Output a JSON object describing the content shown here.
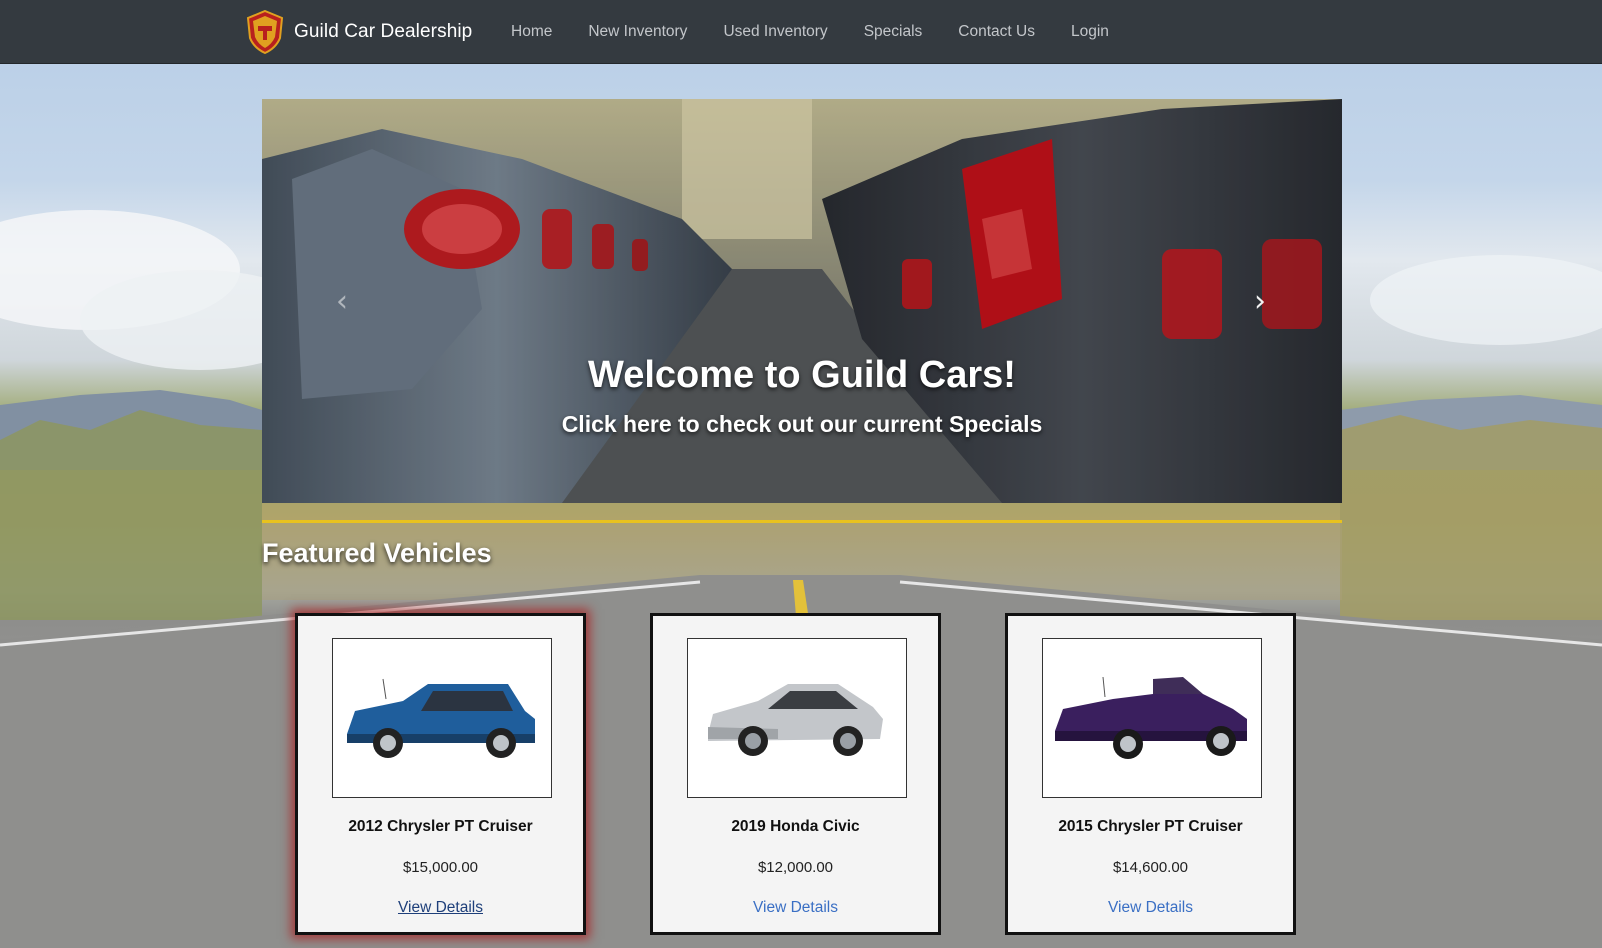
{
  "navbar": {
    "brand": "Guild Car Dealership",
    "items": [
      {
        "label": "Home"
      },
      {
        "label": "New Inventory"
      },
      {
        "label": "Used Inventory"
      },
      {
        "label": "Specials"
      },
      {
        "label": "Contact Us"
      },
      {
        "label": "Login"
      }
    ]
  },
  "carousel": {
    "title": "Welcome to Guild Cars!",
    "subtitle": "Click here to check out our current Specials",
    "prev_icon": "‹",
    "next_icon": "›"
  },
  "featured": {
    "heading": "Featured Vehicles",
    "vehicles": [
      {
        "title": "2012 Chrysler PT Cruiser",
        "price": "$15,000.00",
        "link": "View Details",
        "color": "#1f5e9c"
      },
      {
        "title": "2019 Honda Civic",
        "price": "$12,000.00",
        "link": "View Details",
        "color": "#b9bcc0"
      },
      {
        "title": "2015 Chrysler PT Cruiser",
        "price": "$14,600.00",
        "link": "View Details",
        "color": "#3a1f5e"
      }
    ]
  },
  "colors": {
    "navbar_bg": "#343a40",
    "accent_divider": "#e8c21e",
    "link": "#3a6fc4"
  }
}
